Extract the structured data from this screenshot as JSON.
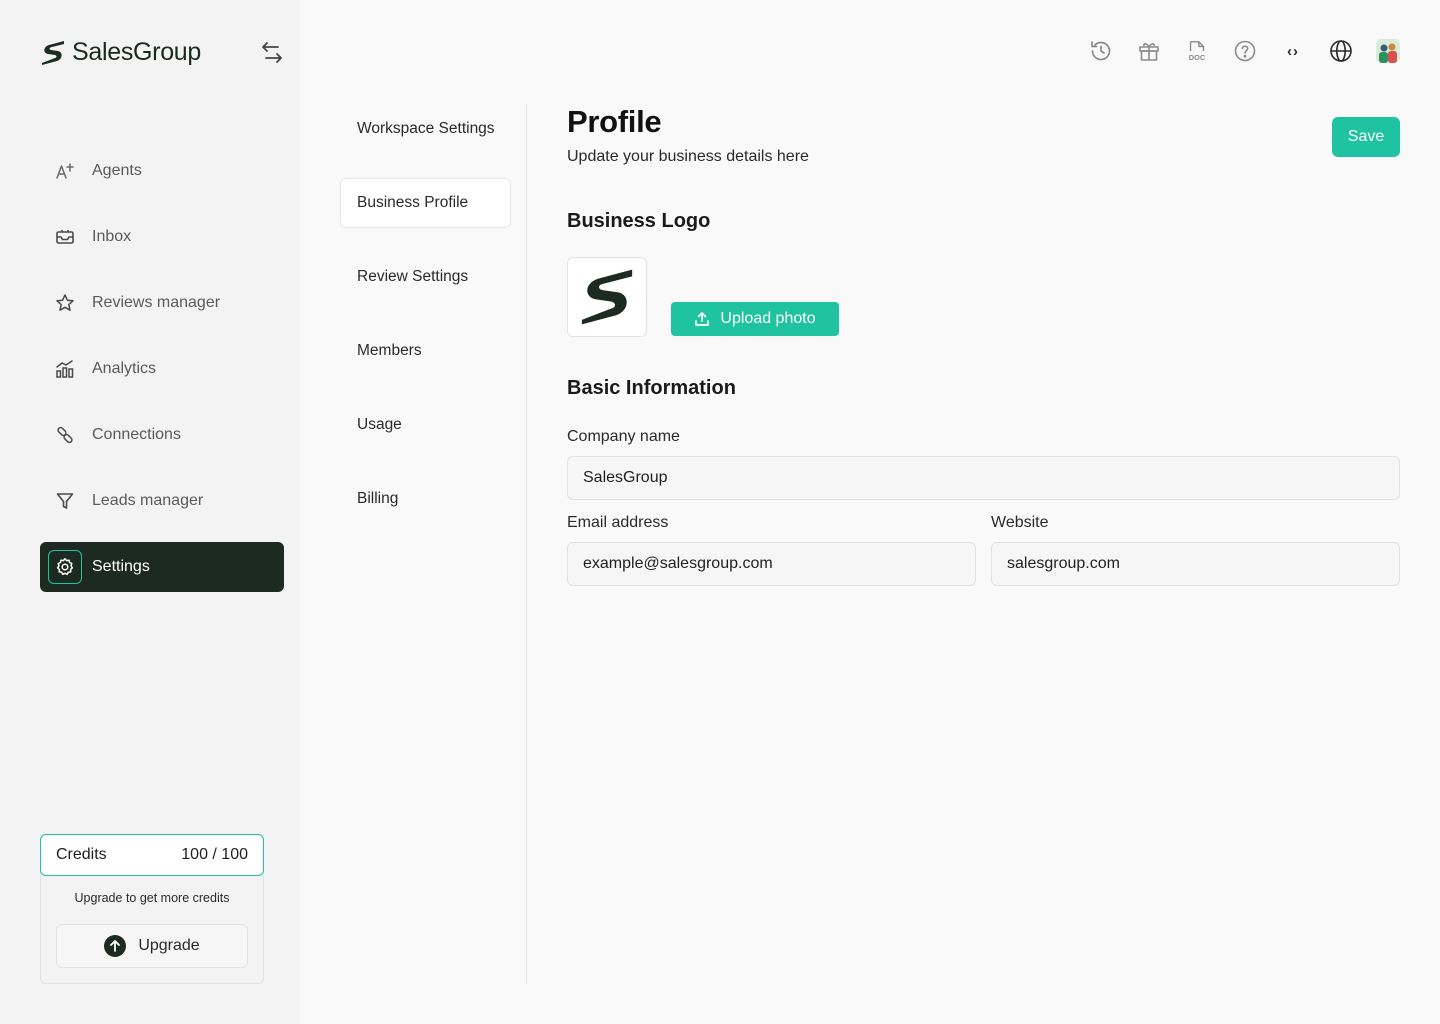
{
  "app": {
    "name": "SalesGroup"
  },
  "sidebar": {
    "items": [
      {
        "label": "Agents",
        "icon": "ai-sparkle-icon"
      },
      {
        "label": "Inbox",
        "icon": "inbox-icon"
      },
      {
        "label": "Reviews manager",
        "icon": "star-icon"
      },
      {
        "label": "Analytics",
        "icon": "analytics-icon"
      },
      {
        "label": "Connections",
        "icon": "link-icon"
      },
      {
        "label": "Leads manager",
        "icon": "filter-icon"
      },
      {
        "label": "Settings",
        "icon": "gear-icon",
        "active": true
      }
    ],
    "credits": {
      "label": "Credits",
      "value": "100 / 100",
      "note": "Upgrade to get more credits",
      "upgrade_label": "Upgrade"
    }
  },
  "topbar": {
    "icons": [
      "history-icon",
      "gift-icon",
      "doc-icon",
      "help-icon",
      "code-icon",
      "globe-icon",
      "avatar"
    ],
    "code_glyph": "‹›"
  },
  "settings_nav": {
    "items": [
      {
        "label": "Workspace Settings"
      },
      {
        "label": "Business Profile",
        "active": true
      },
      {
        "label": "Review Settings"
      },
      {
        "label": "Members"
      },
      {
        "label": "Usage"
      },
      {
        "label": "Billing"
      }
    ]
  },
  "main": {
    "title": "Profile",
    "subtitle": "Update your business details here",
    "save_label": "Save",
    "logo_section": {
      "heading": "Business Logo",
      "upload_label": "Upload photo"
    },
    "basic_info": {
      "heading": "Basic Information",
      "company_name": {
        "label": "Company name",
        "value": "SalesGroup"
      },
      "email": {
        "label": "Email address",
        "value": "example@salesgroup.com"
      },
      "website": {
        "label": "Website",
        "value": "salesgroup.com"
      }
    }
  },
  "colors": {
    "accent": "#20c3a0",
    "dark": "#1d2a21",
    "sidebar_bg": "#f3f3f3",
    "page_bg": "#f9f9f9"
  }
}
